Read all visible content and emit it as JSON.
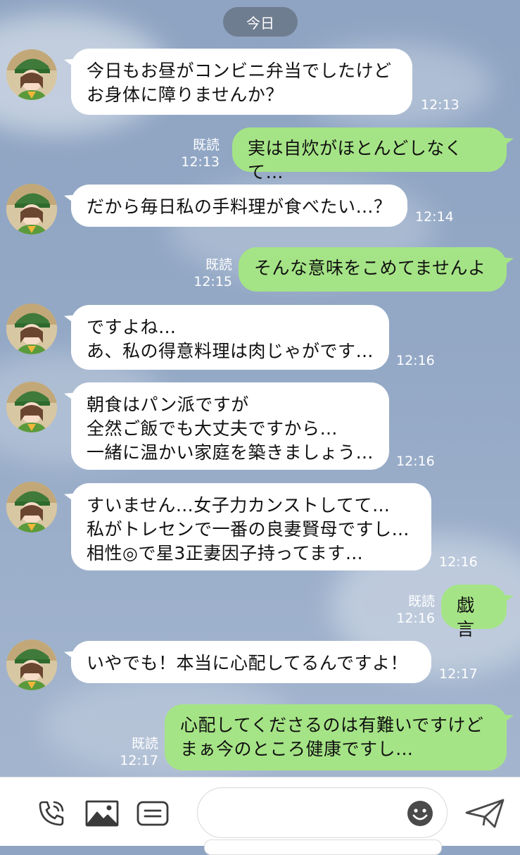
{
  "chat": {
    "date_label": "今日",
    "messages": [
      {
        "text": "今日もお昼がコンビニ弁当でしたけど\nお身体に障りませんか？",
        "time": "12:13"
      },
      {
        "text": "実は自炊がほとんどしなくて…",
        "read": "既読",
        "time": "12:13"
      },
      {
        "text": "だから毎日私の手料理が食べたい…？",
        "time": "12:14"
      },
      {
        "text": "そんな意味をこめてませんよ",
        "read": "既読",
        "time": "12:15"
      },
      {
        "text": "ですよね…\nあ、私の得意料理は肉じゃがです…",
        "time": "12:16"
      },
      {
        "text": "朝食はパン派ですが\n全然ご飯でも大丈夫ですから…\n一緒に温かい家庭を築きましょう…",
        "time": "12:16"
      },
      {
        "text": "すいません…女子力カンストしてて…\n私がトレセンで一番の良妻賢母ですし…\n相性◎で星3正妻因子持ってます…",
        "time": "12:16"
      },
      {
        "text": "戯言",
        "read": "既読",
        "time": "12:16"
      },
      {
        "text": "いやでも！本当に心配してるんですよ！",
        "time": "12:17"
      },
      {
        "text": "心配してくださるのは有難いですけど\nまぁ今のところ健康ですし…",
        "read": "既読",
        "time": "12:17"
      }
    ]
  },
  "input": {
    "placeholder": "",
    "value": ""
  },
  "icons": {
    "call": "phone-icon",
    "image": "image-icon",
    "stamp": "stamp-list-icon",
    "emoji": "smiley-icon",
    "send": "send-icon"
  },
  "colors": {
    "outgoing_bubble": "#a5e486",
    "incoming_bubble": "#ffffff",
    "date_pill": "#6f7d90"
  }
}
